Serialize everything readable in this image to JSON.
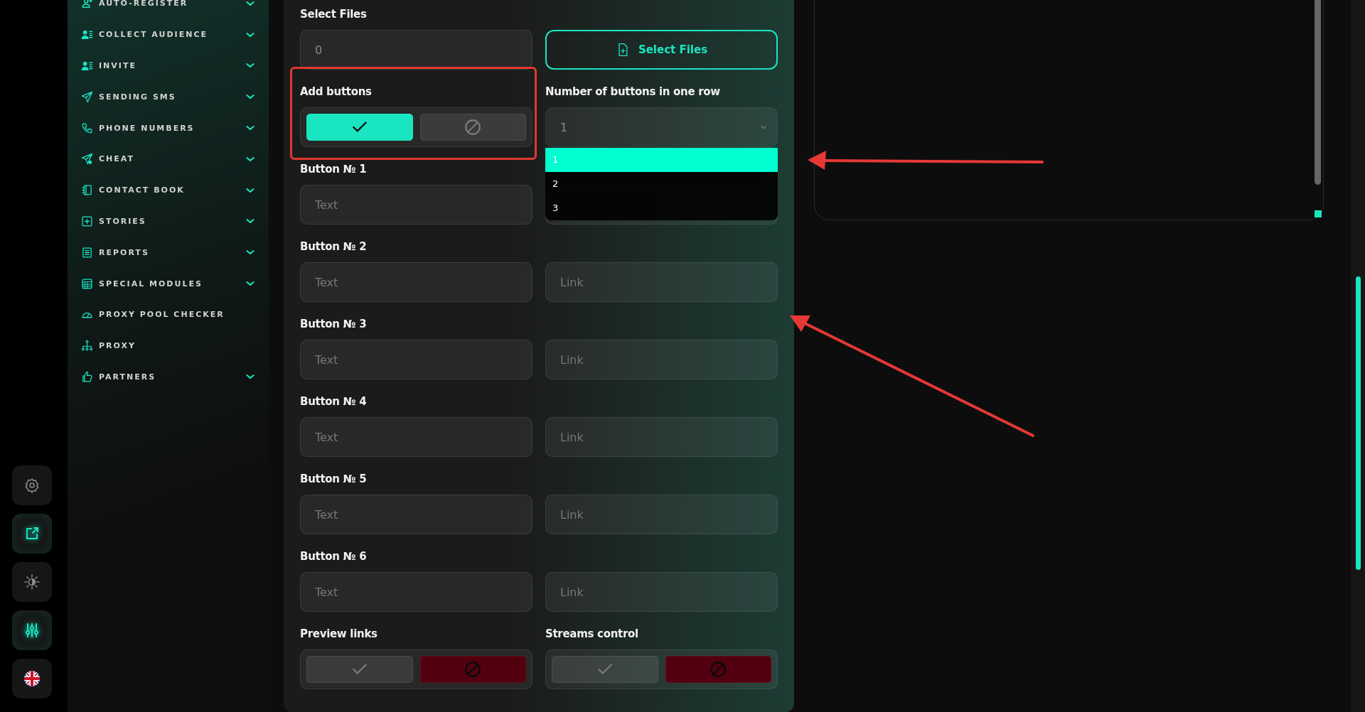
{
  "rail": {
    "buttons": [
      {
        "active": false
      },
      {
        "active": true
      },
      {
        "active": false
      },
      {
        "active": true
      },
      {
        "active": false
      }
    ]
  },
  "sidebar": {
    "items": [
      {
        "label": "AUTO-REGISTER",
        "expandable": true
      },
      {
        "label": "COLLECT AUDIENCE",
        "expandable": true
      },
      {
        "label": "INVITE",
        "expandable": true
      },
      {
        "label": "SENDING SMS",
        "expandable": true
      },
      {
        "label": "PHONE NUMBERS",
        "expandable": true
      },
      {
        "label": "CHEAT",
        "expandable": true
      },
      {
        "label": "CONTACT BOOK",
        "expandable": true
      },
      {
        "label": "STORIES",
        "expandable": true
      },
      {
        "label": "REPORTS",
        "expandable": true
      },
      {
        "label": "SPECIAL MODULES",
        "expandable": true
      },
      {
        "label": "PROXY POOL CHECKER",
        "expandable": false
      },
      {
        "label": "PROXY",
        "expandable": false
      },
      {
        "label": "PARTNERS",
        "expandable": true
      }
    ]
  },
  "form": {
    "select_files": {
      "label": "Select Files",
      "count": "0",
      "button": "Select Files"
    },
    "add_buttons": {
      "label": "Add buttons",
      "enabled": true
    },
    "row_count": {
      "label": "Number of buttons in one row",
      "value": "1",
      "options": [
        {
          "label": "1",
          "selected": true
        },
        {
          "label": "2",
          "selected": false
        },
        {
          "label": "3",
          "selected": false
        }
      ]
    },
    "buttons": [
      {
        "label": "Button № 1",
        "text_placeholder": "Text"
      },
      {
        "label": "Button № 2",
        "text_placeholder": "Text",
        "link_placeholder": "Link"
      },
      {
        "label": "Button № 3",
        "text_placeholder": "Text",
        "link_placeholder": "Link"
      },
      {
        "label": "Button № 4",
        "text_placeholder": "Text",
        "link_placeholder": "Link"
      },
      {
        "label": "Button № 5",
        "text_placeholder": "Text",
        "link_placeholder": "Link"
      },
      {
        "label": "Button № 6",
        "text_placeholder": "Text",
        "link_placeholder": "Link"
      }
    ],
    "preview_links": {
      "label": "Preview links",
      "enabled": false
    },
    "streams_control": {
      "label": "Streams control",
      "enabled": false
    }
  }
}
